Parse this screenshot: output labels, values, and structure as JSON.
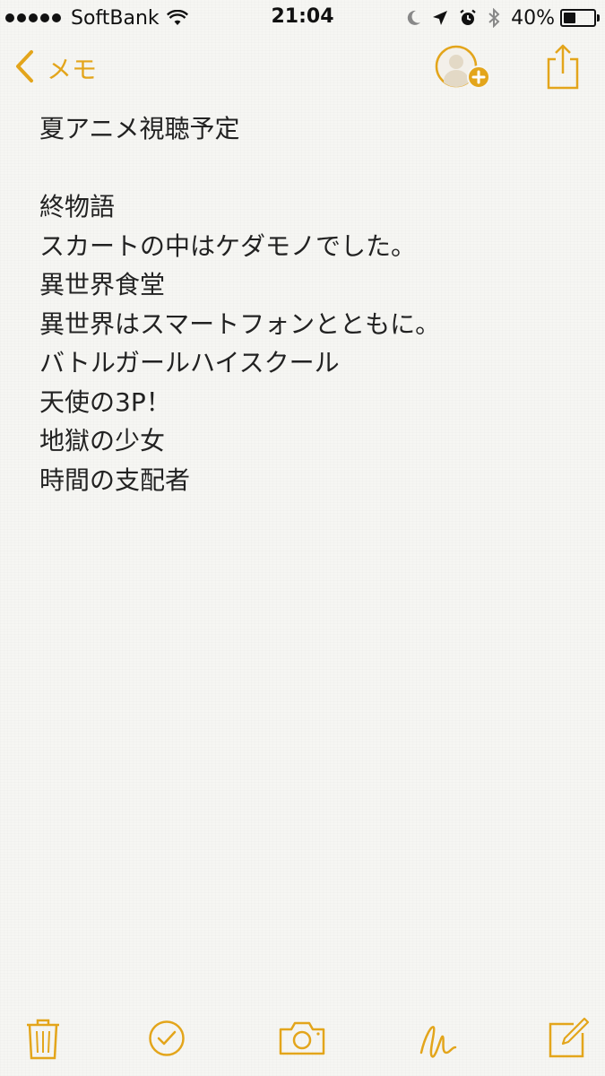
{
  "status_bar": {
    "carrier": "SoftBank",
    "signal_bars": 5,
    "time": "21:04",
    "battery_percent": "40%",
    "battery_level": 0.4,
    "icons": [
      "signal-icon",
      "wifi-icon",
      "moon-icon",
      "location-arrow-icon",
      "alarm-icon",
      "bluetooth-icon",
      "battery-icon"
    ]
  },
  "nav": {
    "back_label": "メモ",
    "accent_color": "#e3a51b",
    "icons": [
      "chevron-left-icon",
      "add-person-icon",
      "share-icon"
    ]
  },
  "note": {
    "lines": [
      "夏アニメ視聴予定",
      "",
      "終物語",
      "スカートの中はケダモノでした。",
      "異世界食堂",
      "異世界はスマートフォンとともに。",
      "バトルガールハイスクール",
      "天使の3P！",
      "地獄の少女",
      "時間の支配者"
    ]
  },
  "toolbar": {
    "icons": [
      "trash-icon",
      "checklist-icon",
      "camera-icon",
      "sketch-icon",
      "compose-icon"
    ]
  }
}
